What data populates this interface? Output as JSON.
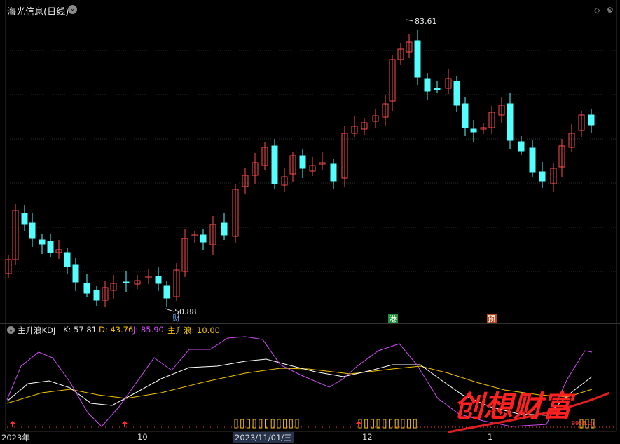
{
  "header": {
    "stock_title": "海光信息(日线)",
    "dropdown_glyph": "⌄",
    "diamond_glyph": "◇",
    "settings_glyph": "⚙"
  },
  "price_chart": {
    "max_label": "83.61",
    "min_label": "50.88",
    "markers": [
      {
        "text": "财",
        "color": "#7fb6ff"
      },
      {
        "text": "港",
        "color": "#ffffff",
        "bg": "#1e8f3a"
      },
      {
        "text": "预",
        "color": "#ffffff",
        "bg": "#b34a1e"
      }
    ]
  },
  "indicator": {
    "name": "主升浪KDJ",
    "k_label": "K: 57.81",
    "d_label": "D: 43.76",
    "j_label": "J: 85.90",
    "zsl_label": "主升浪: 10.00"
  },
  "colors": {
    "up": "#ff4d4d",
    "down": "#54ffff",
    "k": "#ffffff",
    "d": "#f2c200",
    "j": "#d04cf4",
    "accent_red": "#ff2a2a"
  },
  "x_axis": {
    "labels": [
      "2023年",
      "10",
      "2023/11/01/三",
      "12",
      "1"
    ]
  },
  "watermark": {
    "text": "创想财富",
    "small_text": "9958.cn"
  }
}
